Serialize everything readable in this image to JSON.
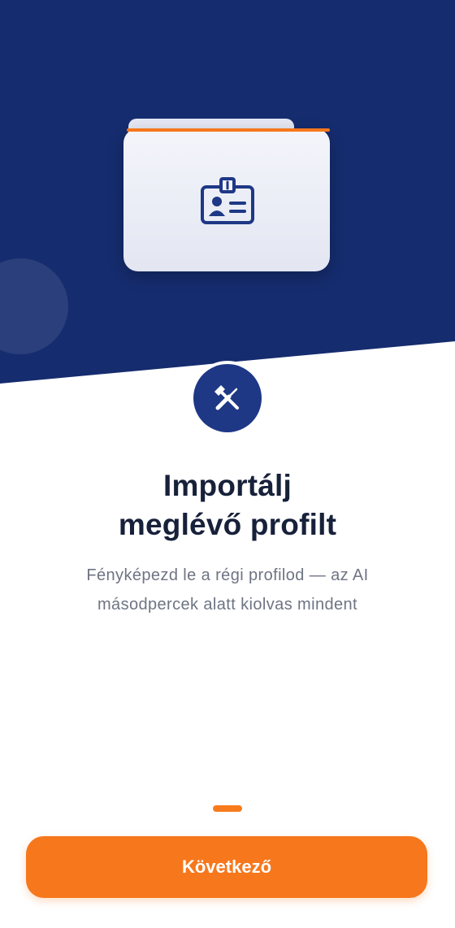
{
  "hero": {
    "illustration_icon": "id-badge-icon",
    "background_color": "#152c6e",
    "accent_color": "#f7771c"
  },
  "feature_icon": "tools-icon",
  "content": {
    "title_line1": "Importálj",
    "title_line2": "meglévő profilt",
    "subtitle_line1": "Fényképezd le a régi profilod — az AI",
    "subtitle_line2": "másodpercek alatt kiolvas mindent"
  },
  "pagination": {
    "current_page": 1
  },
  "actions": {
    "next_label": "Következő"
  }
}
